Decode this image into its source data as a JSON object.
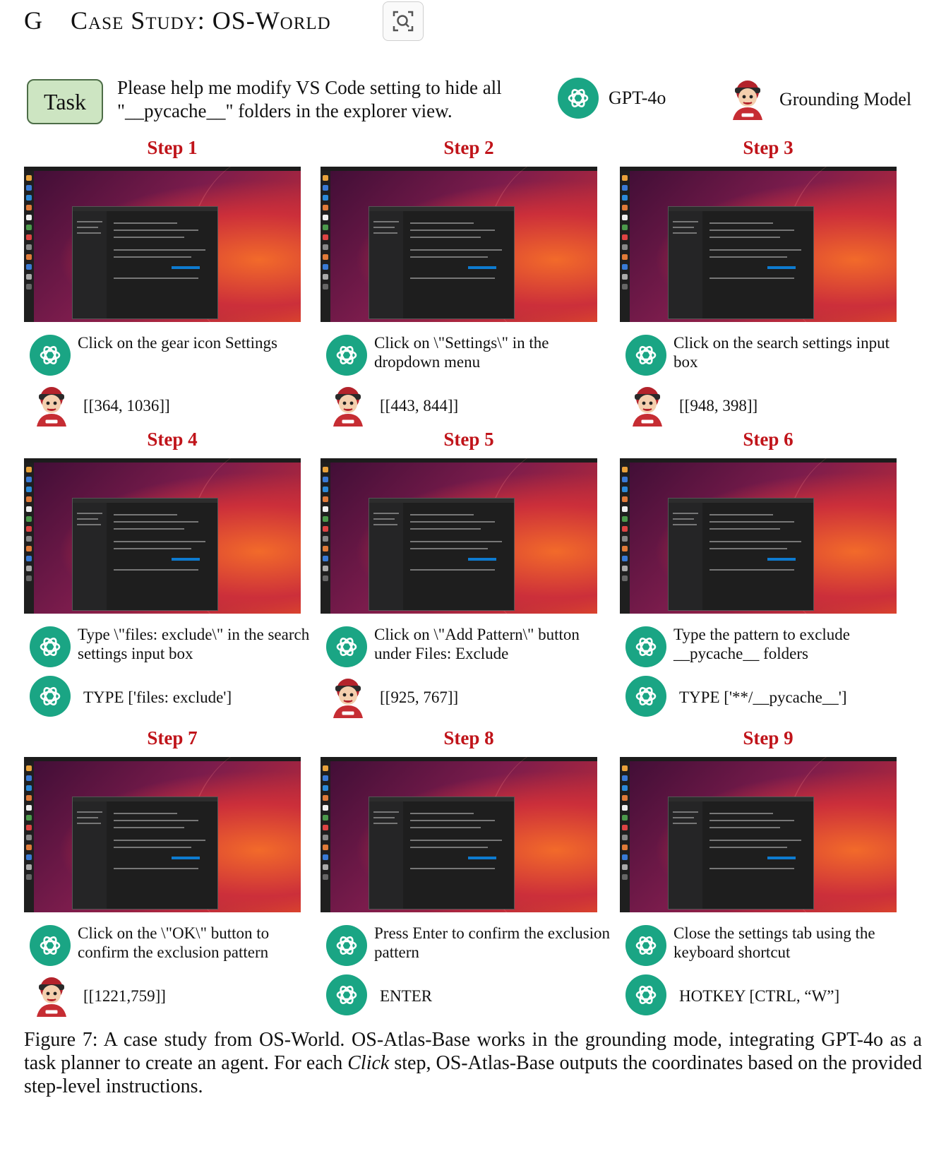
{
  "header": {
    "letter": "G",
    "title": "Case Study: OS-World"
  },
  "task": {
    "badge": "Task",
    "text": "Please help me modify VS Code setting to hide all \"__pycache__\" folders in the explorer view."
  },
  "legend": {
    "planner": "GPT-4o",
    "grounder": "Grounding Model"
  },
  "steps": [
    {
      "title": "Step 1",
      "action": "Click on the gear icon Settings",
      "output": "[[364, 1036]]",
      "output_source": "grounding"
    },
    {
      "title": "Step 2",
      "action": "Click on \\\"Settings\\\" in the dropdown menu",
      "output": "[[443, 844]]",
      "output_source": "grounding"
    },
    {
      "title": "Step 3",
      "action": "Click on the search settings input box",
      "output": "[[948, 398]]",
      "output_source": "grounding"
    },
    {
      "title": "Step 4",
      "action": "Type \\\"files: exclude\\\" in the search settings input box",
      "output": "TYPE ['files: exclude']",
      "output_source": "gpt"
    },
    {
      "title": "Step 5",
      "action": "Click on \\\"Add Pattern\\\" button under Files: Exclude",
      "output": "[[925, 767]]",
      "output_source": "grounding"
    },
    {
      "title": "Step 6",
      "action": "Type the pattern to exclude __pycache__ folders",
      "output": "TYPE ['**/__pycache__']",
      "output_source": "gpt"
    },
    {
      "title": "Step 7",
      "action": "Click on the \\\"OK\\\" button to confirm the exclusion pattern",
      "output": "[[1221,759]]",
      "output_source": "grounding"
    },
    {
      "title": "Step 8",
      "action": "Press Enter to confirm the exclusion pattern",
      "output": "ENTER",
      "output_source": "gpt"
    },
    {
      "title": "Step 9",
      "action": "Close the settings tab using the keyboard shortcut",
      "output": "HOTKEY [CTRL, “W”]",
      "output_source": "gpt"
    }
  ],
  "caption": {
    "p1": "Figure 7: A case study from OS-World. OS-Atlas-Base works in the grounding mode, integrating GPT-4o as a task planner to create an agent.  For each ",
    "italic": "Click",
    "p2": " step, OS-Atlas-Base outputs the coordinates based on the provided step-level instructions."
  }
}
